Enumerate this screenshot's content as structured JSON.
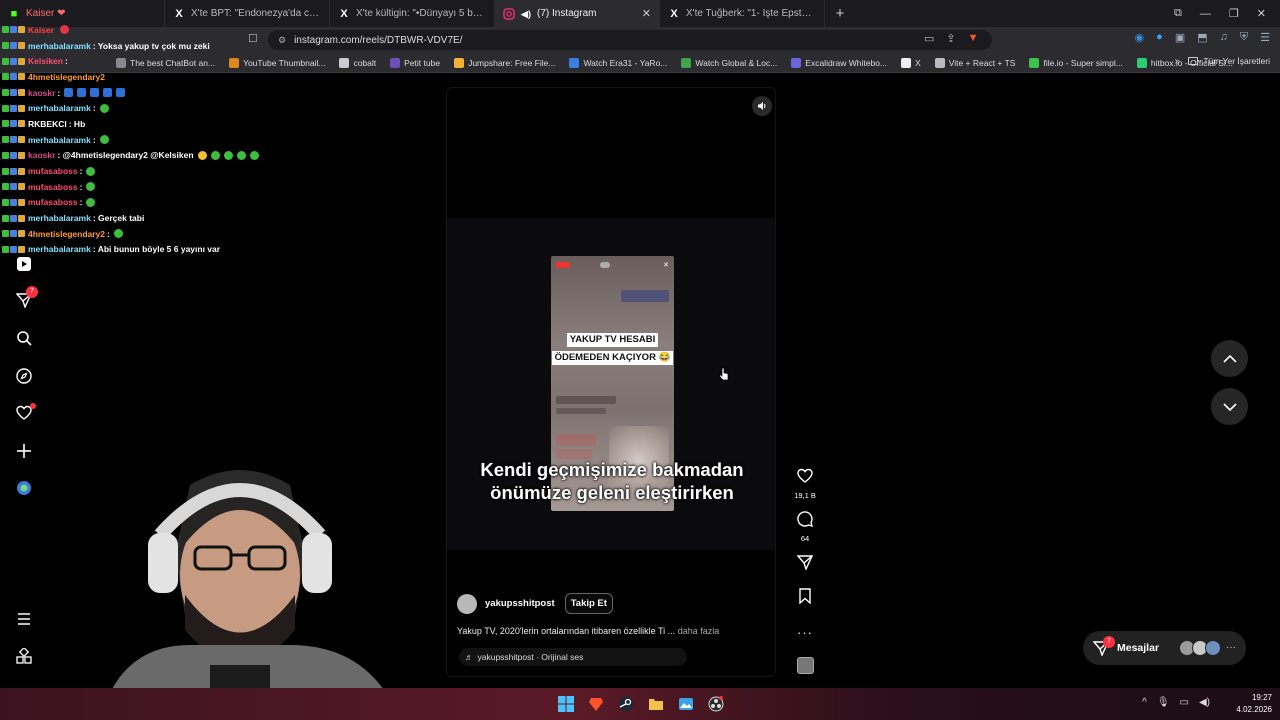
{
  "browser": {
    "tabs": [
      {
        "label": "Kaiser ❤",
        "icon": "kick-icon",
        "active": false
      },
      {
        "label": "X'te BPT: \"Endonezya'da camiye gide",
        "icon": "x-icon",
        "active": false
      },
      {
        "label": "X'te kültigin: \"•Dünyayı 5 büyük aile y",
        "icon": "x-icon",
        "active": false
      },
      {
        "label": "(7) Instagram",
        "icon": "instagram-icon",
        "active": true
      },
      {
        "label": "X'te Tuğberk: \"1- İşte Epstein dosyas",
        "icon": "x-icon",
        "active": false
      }
    ],
    "url": "instagram.com/reels/DTBWR-VDV7E/",
    "bookmarks": [
      {
        "label": "The best ChatBot an...",
        "color": "#888888"
      },
      {
        "label": "YouTube Thumbnail...",
        "color": "#d98a1b"
      },
      {
        "label": "cobalt",
        "color": "#cccccc"
      },
      {
        "label": "Petit tube",
        "color": "#6a4fb8"
      },
      {
        "label": "Jumpshare: Free File...",
        "color": "#f2b233"
      },
      {
        "label": "Watch Era31 - YaRo...",
        "color": "#3a7ee0"
      },
      {
        "label": "Watch Global & Loc...",
        "color": "#40a34a"
      },
      {
        "label": "Excalidraw Whitebo...",
        "color": "#6965db"
      },
      {
        "label": "X",
        "color": "#eeeeee"
      },
      {
        "label": "Vite + React + TS",
        "color": "#bbbbbb"
      },
      {
        "label": "file.io - Super simpl...",
        "color": "#3cc34a"
      },
      {
        "label": "hitbox.io - Official Si...",
        "color": "#2ecc71"
      }
    ],
    "bookmarks_all": "Tüm Yer İşaretleri"
  },
  "chat": [
    {
      "user": "Kaiser",
      "user_color": "#ff3d3d",
      "msg": "",
      "emote": "heart"
    },
    {
      "user": "merhabalaramk",
      "user_color": "#7fe0ff",
      "msg": ": Yoksa yakup tv çok mu zeki",
      "emote": ""
    },
    {
      "user": "Kelsiken",
      "user_color": "#ff4d6d",
      "msg": ":",
      "emote": ""
    },
    {
      "user": "4hmetislegendary2",
      "user_color": "#ff9d2e",
      "msg": "",
      "emote": ""
    },
    {
      "user": "kaoskr",
      "user_color": "#d84a8c",
      "msg": ":",
      "emote": "blue"
    },
    {
      "user": "merhabalaramk",
      "user_color": "#7fe0ff",
      "msg": ":",
      "emote": "green"
    },
    {
      "user": "RKBEKCI",
      "user_color": "#ffffff",
      "msg": ": Hb",
      "emote": ""
    },
    {
      "user": "merhabalaramk",
      "user_color": "#7fe0ff",
      "msg": ":",
      "emote": "green"
    },
    {
      "user": "kaoskr",
      "user_color": "#d84a8c",
      "msg": ": @4hmetislegendary2 @Kelsiken",
      "emote": "yellow"
    },
    {
      "user": "mufasaboss",
      "user_color": "#ff4d6d",
      "msg": ":",
      "emote": "green"
    },
    {
      "user": "mufasaboss",
      "user_color": "#ff4d6d",
      "msg": ":",
      "emote": "green"
    },
    {
      "user": "mufasaboss",
      "user_color": "#ff4d6d",
      "msg": ":",
      "emote": "green"
    },
    {
      "user": "merhabalaramk",
      "user_color": "#7fe0ff",
      "msg": ": Gerçek tabi",
      "emote": ""
    },
    {
      "user": "4hmetislegendary2",
      "user_color": "#ff9d2e",
      "msg": ":",
      "emote": "green"
    },
    {
      "user": "merhabalaramk",
      "user_color": "#7fe0ff",
      "msg": ": Abi bunun böyle 5 6 yayını var",
      "emote": ""
    }
  ],
  "sidebar": {
    "notif_count": "7"
  },
  "reel": {
    "overlay_title_line1": "YAKUP TV HESABI",
    "overlay_title_line2": "ÖDEMEDEN KAÇIYOR 😂",
    "caption_line1": "Kendi geçmişimize bakmadan",
    "caption_line2": "önümüze geleni eleştirirken",
    "owner": "yakupsshitpost",
    "follow_label": "Takip Et",
    "description": "Yakup TV, 2020'lerin ortalarından itibaren özellikle Ti ...",
    "more_label": "daha fazla",
    "audio": "yakupsshitpost · Orijinal ses",
    "likes": "19,1 B",
    "comments": "64"
  },
  "messages": {
    "label": "Mesajlar",
    "badge": "7"
  },
  "taskbar": {
    "time": "19:27",
    "date": "4.02.2026"
  },
  "colors": {
    "instagram_red": "#ff3040",
    "accent_green": "#3cbf3c"
  }
}
